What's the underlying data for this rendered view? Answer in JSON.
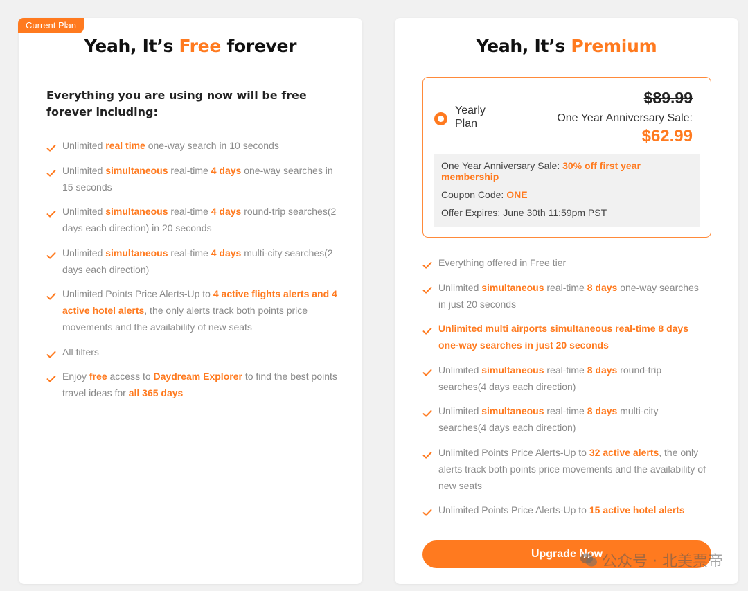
{
  "free_plan": {
    "badge": "Current Plan",
    "title_prefix": "Yeah, It’s ",
    "title_accent": "Free",
    "title_suffix": " forever",
    "intro": "Everything you are using now will be free forever including:",
    "features": [
      [
        {
          "t": "Unlimited "
        },
        {
          "t": "real time",
          "hl": true
        },
        {
          "t": " one-way search in 10 seconds"
        }
      ],
      [
        {
          "t": "Unlimited "
        },
        {
          "t": "simultaneous",
          "hl": true
        },
        {
          "t": " real-time "
        },
        {
          "t": "4 days",
          "hl": true
        },
        {
          "t": " one-way searches in 15 seconds"
        }
      ],
      [
        {
          "t": "Unlimited "
        },
        {
          "t": "simultaneous",
          "hl": true
        },
        {
          "t": " real-time "
        },
        {
          "t": "4 days",
          "hl": true
        },
        {
          "t": " round-trip searches(2 days each direction) in 20 seconds"
        }
      ],
      [
        {
          "t": "Unlimited "
        },
        {
          "t": "simultaneous",
          "hl": true
        },
        {
          "t": " real-time "
        },
        {
          "t": "4 days",
          "hl": true
        },
        {
          "t": " multi-city searches(2 days each direction)"
        }
      ],
      [
        {
          "t": "Unlimited Points Price Alerts-Up to "
        },
        {
          "t": "4 active flights alerts and 4 active hotel alerts",
          "hl": true
        },
        {
          "t": ", the only alerts track both points price movements and the availability of new seats"
        }
      ],
      [
        {
          "t": "All filters"
        }
      ],
      [
        {
          "t": "Enjoy "
        },
        {
          "t": "free",
          "hl": true
        },
        {
          "t": " access to "
        },
        {
          "t": "Daydream Explorer",
          "hl": true
        },
        {
          "t": " to find the best points travel ideas for "
        },
        {
          "t": "all 365 days",
          "hl": true
        }
      ]
    ]
  },
  "premium_plan": {
    "title_prefix": "Yeah, It’s ",
    "title_accent": "Premium",
    "plan_name": "Yearly Plan",
    "old_price": "$89.99",
    "sale_label": "One Year Anniversary Sale:",
    "new_price": "$62.99",
    "offer": {
      "sale_prefix": "One Year Anniversary Sale: ",
      "sale_value": "30% off first year membership",
      "coupon_prefix": "Coupon Code: ",
      "coupon_value": "ONE",
      "expires": "Offer Expires: June 30th 11:59pm PST"
    },
    "features": [
      [
        {
          "t": "Everything offered in Free tier"
        }
      ],
      [
        {
          "t": "Unlimited "
        },
        {
          "t": "simultaneous",
          "hl": true
        },
        {
          "t": " real-time "
        },
        {
          "t": "8 days",
          "hl": true
        },
        {
          "t": " one-way searches in just 20 seconds"
        }
      ],
      [
        {
          "t": "Unlimited multi airports simultaneous real-time 8 days one-way searches in just 20 seconds",
          "hl": true
        }
      ],
      [
        {
          "t": "Unlimited "
        },
        {
          "t": "simultaneous",
          "hl": true
        },
        {
          "t": " real-time "
        },
        {
          "t": "8 days",
          "hl": true
        },
        {
          "t": " round-trip searches(4 days each direction)"
        }
      ],
      [
        {
          "t": "Unlimited "
        },
        {
          "t": "simultaneous",
          "hl": true
        },
        {
          "t": " real-time "
        },
        {
          "t": "8 days",
          "hl": true
        },
        {
          "t": " multi-city searches(4 days each direction)"
        }
      ],
      [
        {
          "t": "Unlimited Points Price Alerts-Up to "
        },
        {
          "t": "32 active alerts",
          "hl": true
        },
        {
          "t": ", the only alerts track both points price movements and the availability of new seats"
        }
      ],
      [
        {
          "t": "Unlimited Points Price Alerts-Up to "
        },
        {
          "t": "15 active hotel alerts",
          "hl": true
        }
      ]
    ],
    "upgrade_label": "Upgrade Now"
  },
  "watermark": {
    "text": "公众号 · 北美票帝",
    "icon": "wechat-icon"
  },
  "colors": {
    "accent": "#ff7a1f",
    "background": "#f1f1f1",
    "card": "#ffffff"
  }
}
